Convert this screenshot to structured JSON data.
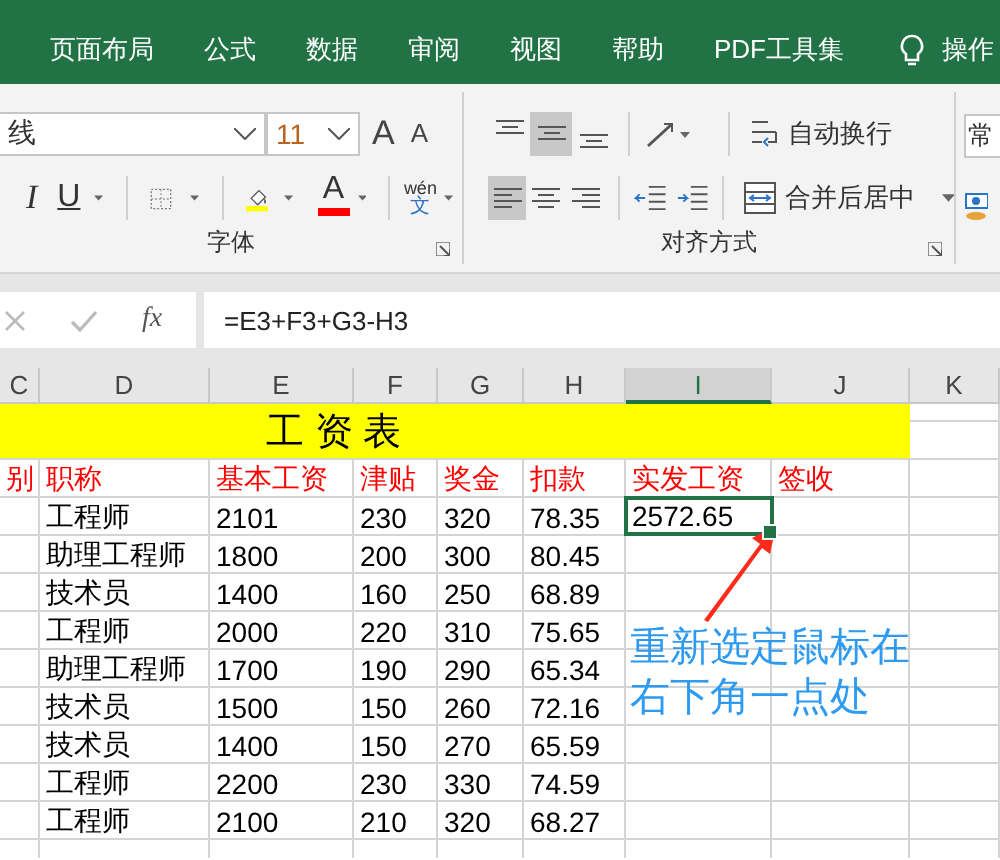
{
  "ribbon_tabs": [
    {
      "label": "页面布局"
    },
    {
      "label": "公式"
    },
    {
      "label": "数据"
    },
    {
      "label": "审阅"
    },
    {
      "label": "视图"
    },
    {
      "label": "帮助"
    },
    {
      "label": "PDF工具集"
    }
  ],
  "tell_me": "操作",
  "ribbon": {
    "font_name": "线",
    "font_size": "11",
    "grow_font": "A",
    "shrink_font": "A",
    "italic": "I",
    "underline": "U",
    "font_color": "A",
    "phonetic_top": "wén",
    "phonetic_bottom": "文",
    "align_vertical": [
      {
        "kind": "top",
        "selected": false
      },
      {
        "kind": "middle",
        "selected": true
      },
      {
        "kind": "bottom",
        "selected": false
      }
    ],
    "align_horizontal": [
      {
        "kind": "left",
        "selected": true
      },
      {
        "kind": "center",
        "selected": false
      },
      {
        "kind": "right",
        "selected": false
      }
    ],
    "wrap_text": "自动换行",
    "merge_center": "合并后居中",
    "number_format": "常",
    "groups": [
      "字体",
      "对齐方式"
    ]
  },
  "formula_bar": {
    "fx": "fx",
    "formula": "=E3+F3+G3-H3"
  },
  "sheet": {
    "columns": [
      {
        "label": "C",
        "selected": false
      },
      {
        "label": "D",
        "selected": false
      },
      {
        "label": "E",
        "selected": false
      },
      {
        "label": "F",
        "selected": false
      },
      {
        "label": "G",
        "selected": false
      },
      {
        "label": "H",
        "selected": false
      },
      {
        "label": "I",
        "selected": true
      },
      {
        "label": "J",
        "selected": false
      },
      {
        "label": "K",
        "selected": false
      }
    ],
    "title": "工 资 表",
    "headers": [
      "别",
      "职称",
      "基本工资",
      "津贴",
      "奖金",
      "扣款",
      "实发工资",
      "签收"
    ],
    "rows": [
      {
        "title": "工程师",
        "base": "2101",
        "allowance": "230",
        "bonus": "320",
        "deduction": "78.35",
        "net": {
          "text": "2572.65",
          "selected": true
        }
      },
      {
        "title": "助理工程师",
        "base": "1800",
        "allowance": "200",
        "bonus": "300",
        "deduction": "80.45"
      },
      {
        "title": "技术员",
        "base": "1400",
        "allowance": "160",
        "bonus": "250",
        "deduction": "68.89"
      },
      {
        "title": "工程师",
        "base": "2000",
        "allowance": "220",
        "bonus": "310",
        "deduction": "75.65"
      },
      {
        "title": "助理工程师",
        "base": "1700",
        "allowance": "190",
        "bonus": "290",
        "deduction": "65.34"
      },
      {
        "title": "技术员",
        "base": "1500",
        "allowance": "150",
        "bonus": "260",
        "deduction": "72.16"
      },
      {
        "title": "技术员",
        "base": "1400",
        "allowance": "150",
        "bonus": "270",
        "deduction": "65.59"
      },
      {
        "title": "工程师",
        "base": "2200",
        "allowance": "230",
        "bonus": "330",
        "deduction": "74.59"
      },
      {
        "title": "工程师",
        "base": "2100",
        "allowance": "210",
        "bonus": "320",
        "deduction": "68.27"
      }
    ]
  },
  "annotation": {
    "text": "重新选定鼠标在右下角一点处"
  }
}
